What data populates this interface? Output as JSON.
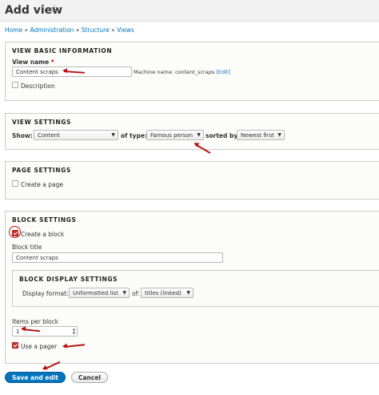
{
  "header": {
    "title": "Add view",
    "star_icon": "star-outline-icon"
  },
  "breadcrumb": [
    "Home",
    "Administration",
    "Structure",
    "Views"
  ],
  "breadcrumb_separator": "»",
  "basic": {
    "legend": "VIEW BASIC INFORMATION",
    "view_name_label": "View name",
    "required_mark": "*",
    "view_name_value": "Content scraps",
    "machine_name_label": "Machine name: content_scraps",
    "edit_link": "[Edit]",
    "description_label": "Description"
  },
  "view_settings": {
    "legend": "VIEW SETTINGS",
    "show_label": "Show:",
    "show_value": "Content",
    "of_type_label": "of type:",
    "of_type_value": "Famous person",
    "sorted_by_label": "sorted by:",
    "sorted_by_value": "Newest first"
  },
  "page_settings": {
    "legend": "PAGE SETTINGS",
    "create_page_label": "Create a page"
  },
  "block_settings": {
    "legend": "BLOCK SETTINGS",
    "create_block_label": "Create a block",
    "create_block_checked": true,
    "block_title_label": "Block title",
    "block_title_value": "Content scraps",
    "display": {
      "legend": "BLOCK DISPLAY SETTINGS",
      "format_label": "Display format:",
      "format_value": "Unformatted list",
      "of_label": "of:",
      "of_value": "titles (linked)"
    },
    "items_label": "Items per block",
    "items_value": "1",
    "pager_label": "Use a pager",
    "pager_checked": true
  },
  "actions": {
    "save_label": "Save and edit",
    "cancel_label": "Cancel"
  },
  "colors": {
    "accent": "#0074bd",
    "annotation": "#b81414",
    "checkbox_checked": "#c9302c"
  }
}
